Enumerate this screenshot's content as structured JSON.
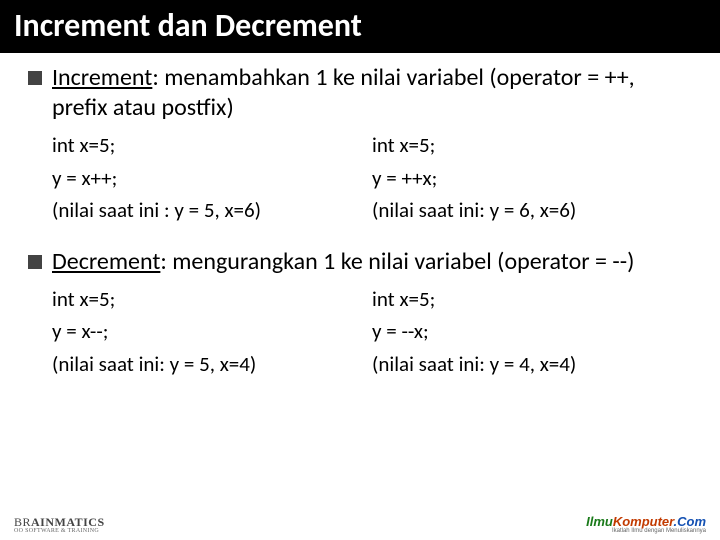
{
  "title": "Increment dan Decrement",
  "sections": [
    {
      "term": "Increment",
      "definition": ": menambahkan 1 ke nilai variabel (operator = ++, prefix atau postfix)",
      "left": {
        "line1": "int x=5;",
        "line2": "y = x++;",
        "line3": "(nilai saat ini : y = 5, x=6)"
      },
      "right": {
        "line1": "int x=5;",
        "line2": "y = ++x;",
        "line3": "(nilai saat ini: y = 6, x=6)"
      }
    },
    {
      "term": "Decrement",
      "definition": ": mengurangkan 1 ke nilai variabel (operator = --)",
      "left": {
        "line1": "int  x=5;",
        "line2": "y = x--;",
        "line3": "(nilai saat ini: y = 5, x=4)"
      },
      "right": {
        "line1": "int x=5;",
        "line2": "y = --x;",
        "line3": "(nilai saat ini: y = 4, x=4)"
      }
    }
  ],
  "footer": {
    "left_brand_lead": "BR",
    "left_brand_rest": "AINMATICS",
    "left_tag": "OO SOFTWARE & TRAINING",
    "right_brand_p1": "Ilmu",
    "right_brand_p2": "Komputer",
    "right_brand_p3": ".Com",
    "right_tag": "Ikatlah Ilmu dengan Menuliskannya"
  }
}
